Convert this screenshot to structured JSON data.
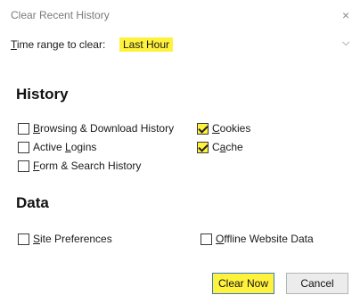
{
  "window": {
    "title": "Clear Recent History",
    "close_glyph": "×"
  },
  "time_range": {
    "label_access": "T",
    "label_rest": "ime range to clear:",
    "selected": "Last Hour",
    "chevron": "⌵"
  },
  "history": {
    "heading": "History",
    "items": [
      {
        "pre": "",
        "key": "B",
        "post": "rowsing & Download History",
        "checked": false
      },
      {
        "pre": "Active ",
        "key": "L",
        "post": "ogins",
        "checked": false
      },
      {
        "pre": "",
        "key": "F",
        "post": "orm & Search History",
        "checked": false
      },
      {
        "pre": "",
        "key": "C",
        "post": "ookies",
        "checked": true
      },
      {
        "pre": "C",
        "key": "a",
        "post": "che",
        "checked": true
      }
    ]
  },
  "data": {
    "heading": "Data",
    "items": [
      {
        "pre": "",
        "key": "S",
        "post": "ite Preferences",
        "checked": false
      },
      {
        "pre": "",
        "key": "O",
        "post": "ffline Website Data",
        "checked": false
      }
    ]
  },
  "buttons": {
    "clear_now": "Clear Now",
    "cancel": "Cancel"
  },
  "colors": {
    "highlight": "#fff23d",
    "focus_border": "#3b78c8"
  }
}
